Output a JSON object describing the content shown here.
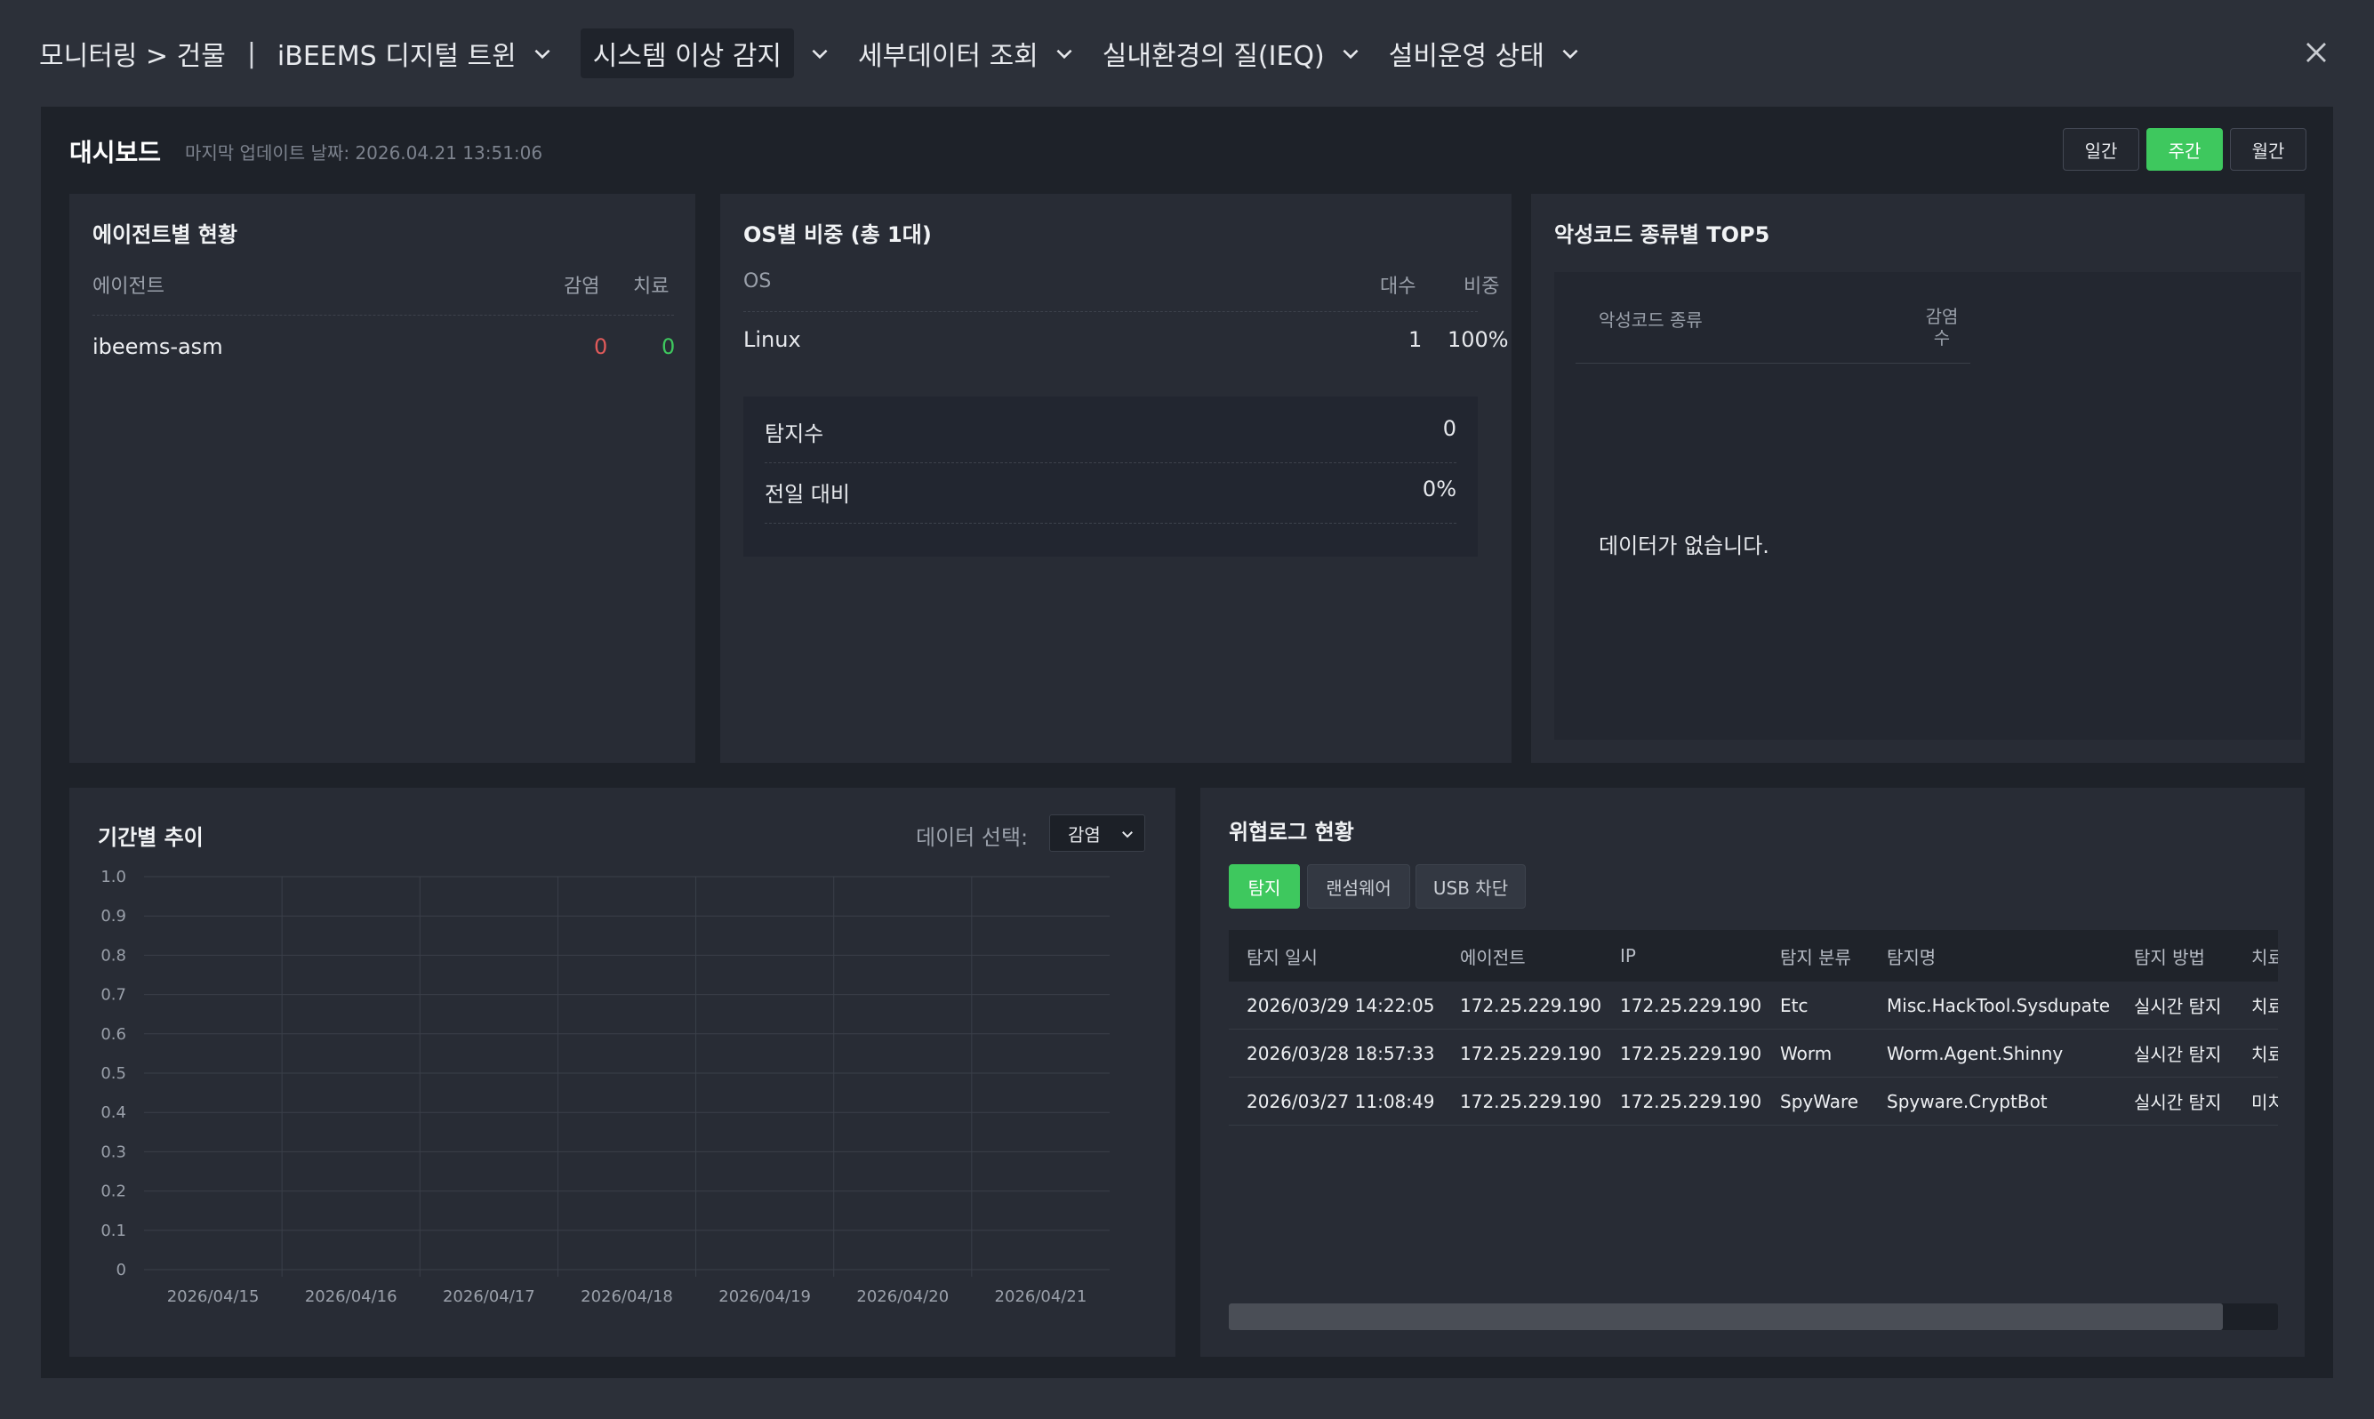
{
  "header": {
    "breadcrumb": "모니터링 > 건물",
    "separator": "|",
    "nav": [
      {
        "label": "iBEEMS 디지털 트윈"
      },
      {
        "label": "시스템 이상 감지"
      },
      {
        "label": "세부데이터 조회"
      },
      {
        "label": "실내환경의 질(IEQ)"
      },
      {
        "label": "설비운영 상태"
      }
    ]
  },
  "dashboard": {
    "title": "대시보드",
    "updated": "마지막 업데이트 날짜: 2026.04.21 13:51:06",
    "periods": [
      "일간",
      "주간",
      "월간"
    ],
    "active_period": "주간"
  },
  "agent_status": {
    "title": "에이전트별 현황",
    "headers": [
      "에이전트",
      "감염",
      "치료"
    ],
    "rows": [
      {
        "agent": "ibeems-asm",
        "infected": "0",
        "cured": "0"
      }
    ]
  },
  "os_share": {
    "title": "OS별 비중 (총 1대)",
    "headers": [
      "OS",
      "대수",
      "비중"
    ],
    "rows": [
      {
        "os": "Linux",
        "count": "1",
        "ratio": "100%"
      }
    ],
    "stats": [
      {
        "label": "탐지수",
        "value": "0"
      },
      {
        "label": "전일 대비",
        "value": "0%"
      }
    ]
  },
  "malware_top5": {
    "title": "악성코드 종류별 TOP5",
    "headers": [
      "악성코드 종류",
      "감염\n수"
    ],
    "empty": "데이터가 없습니다."
  },
  "trend": {
    "title": "기간별 추이",
    "select_label": "데이터 선택:",
    "select_value": "감염"
  },
  "chart_data": {
    "type": "line",
    "categories": [
      "2026/04/15",
      "2026/04/16",
      "2026/04/17",
      "2026/04/18",
      "2026/04/19",
      "2026/04/20",
      "2026/04/21"
    ],
    "yticks": [
      "1.0",
      "0.9",
      "0.8",
      "0.7",
      "0.6",
      "0.5",
      "0.4",
      "0.3",
      "0.2",
      "0.1",
      "0"
    ],
    "ylim": [
      0,
      1
    ],
    "series": [],
    "grid": true
  },
  "threat_log": {
    "title": "위협로그 현황",
    "tabs": [
      "탐지",
      "랜섬웨어",
      "USB 차단"
    ],
    "active_tab": "탐지",
    "headers": [
      "탐지 일시",
      "에이전트",
      "IP",
      "탐지 분류",
      "탐지명",
      "탐지 방법",
      "치료"
    ],
    "rows": [
      [
        "2026/03/29 14:22:05",
        "172.25.229.190",
        "172.25.229.190",
        "Etc",
        "Misc.HackTool.Sysdupate",
        "실시간 탐지",
        "치료"
      ],
      [
        "2026/03/28 18:57:33",
        "172.25.229.190",
        "172.25.229.190",
        "Worm",
        "Worm.Agent.Shinny",
        "실시간 탐지",
        "치료"
      ],
      [
        "2026/03/27 11:08:49",
        "172.25.229.190",
        "172.25.229.190",
        "SpyWare",
        "Spyware.CryptBot",
        "실시간 탐지",
        "미치"
      ]
    ]
  },
  "colors": {
    "accent": "#3ec85e",
    "infected": "#e05a5a",
    "cured": "#3ec85e"
  }
}
